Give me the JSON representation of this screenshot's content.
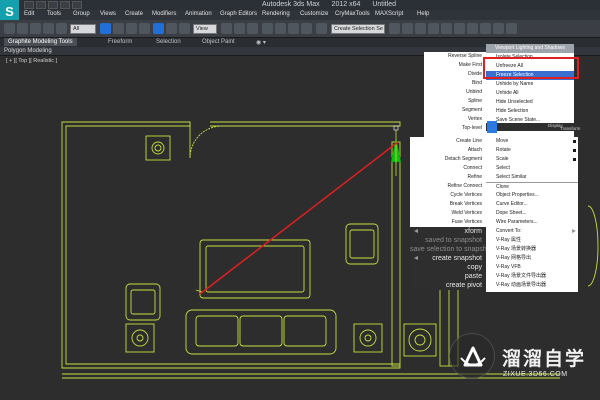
{
  "app": {
    "logo_text": "S",
    "title_parts": [
      "Autodesk 3ds Max",
      "2012 x64",
      "Untitled"
    ]
  },
  "menu": [
    "Edit",
    "Tools",
    "Group",
    "Views",
    "Create",
    "Modifiers",
    "Animation",
    "Graph Editors",
    "Rendering",
    "Customize",
    "CryMaxTools",
    "MAXScript",
    "Help"
  ],
  "toolbar": {
    "selection_filter": "All",
    "view_dropdown": "View",
    "named_selection": "Create Selection Se"
  },
  "ribbon": {
    "tabs": [
      "Graphite Modeling Tools",
      "Freeform",
      "Selection",
      "Object Paint"
    ],
    "active_panel": "Polygon Modeling"
  },
  "viewport": {
    "label": "[ + ][ Top ][ Realistic ]"
  },
  "quad_menu": {
    "top_title": "Viewport Lighting and Shadows",
    "top_right_items": [
      "Isolate Selection",
      "Unfreeze All",
      "Freeze Selection",
      "Unhide by Name",
      "Unhide All",
      "Hide Unselected",
      "Hide Selection",
      "Save Scene State...",
      "Manage Scene States..."
    ],
    "highlighted_item": "Freeze Selection",
    "top_left_items": [
      "Reverse Spline",
      "Make First",
      "Divide",
      "Bind",
      "Unbind",
      "Spline",
      "Segment",
      "Vertex",
      "Top-level"
    ],
    "bottom_left_items": [
      "Create Line",
      "Attach",
      "Detach Segment",
      "Connect",
      "Refine",
      "Refine Connect",
      "Cycle Vertices",
      "Break Vertices",
      "Weld Vertices",
      "Fuse Vertices"
    ],
    "bottom_right_items": [
      "Move",
      "Rotate",
      "Scale",
      "Select",
      "Select Similar",
      "Clone",
      "Object Properties...",
      "Curve Editor...",
      "Dope Sheet...",
      "Wire Parameters...",
      "Convert To:",
      "V-Ray 属性",
      "V-Ray 场景转换器",
      "V-Ray 网格导出",
      "V-Ray VFB",
      "V-Ray 场景文件导出器",
      "V-Ray 动画场景导出器"
    ],
    "extra_left_items": [
      "xform",
      "saved to snapshot",
      "save selection to snapshot",
      "create snapshot",
      "copy",
      "paste",
      "create pivot"
    ],
    "right_edge_labels": [
      "Display",
      "Transform"
    ]
  },
  "watermark": {
    "title": "溜溜自学",
    "url": "ZIXUE.3D66.COM"
  },
  "colors": {
    "wireframe": "#c6df3d",
    "annotation": "#e02020",
    "highlight": "#3a6fd0",
    "gizmo": "#10c010"
  }
}
